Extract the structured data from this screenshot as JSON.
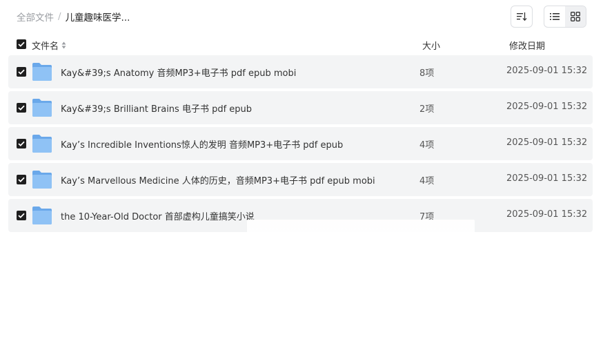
{
  "breadcrumb": {
    "root": "全部文件",
    "separator": "/",
    "current": "儿童趣味医学..."
  },
  "toolbar": {
    "sort_icon": "sort-icon",
    "list_view_icon": "list-view-icon",
    "grid_view_icon": "grid-view-icon",
    "active_view": "list"
  },
  "columns": {
    "name": "文件名",
    "size": "大小",
    "date": "修改日期"
  },
  "rows": [
    {
      "name": "Kay&#39;s Anatomy 音频MP3+电子书 pdf epub mobi",
      "size": "8项",
      "date": "2025-09-01 15:32",
      "checked": true
    },
    {
      "name": "Kay&#39;s Brilliant Brains 电子书 pdf epub",
      "size": "2项",
      "date": "2025-09-01 15:32",
      "checked": true
    },
    {
      "name": "Kay’s Incredible Inventions惊人的发明 音频MP3+电子书 pdf epub",
      "size": "4项",
      "date": "2025-09-01 15:32",
      "checked": true
    },
    {
      "name": "Kay’s Marvellous Medicine 人体的历史，音频MP3+电子书 pdf epub mobi",
      "size": "4项",
      "date": "2025-09-01 15:32",
      "checked": true
    },
    {
      "name": "the 10-Year-Old Doctor 首部虚构儿童搞笑小说",
      "size": "7项",
      "date": "2025-09-01 15:32",
      "checked": true
    }
  ],
  "colors": {
    "row_bg": "#f3f4f5",
    "folder": "#7ab3ee",
    "checkbox": "#1f1f1f"
  }
}
